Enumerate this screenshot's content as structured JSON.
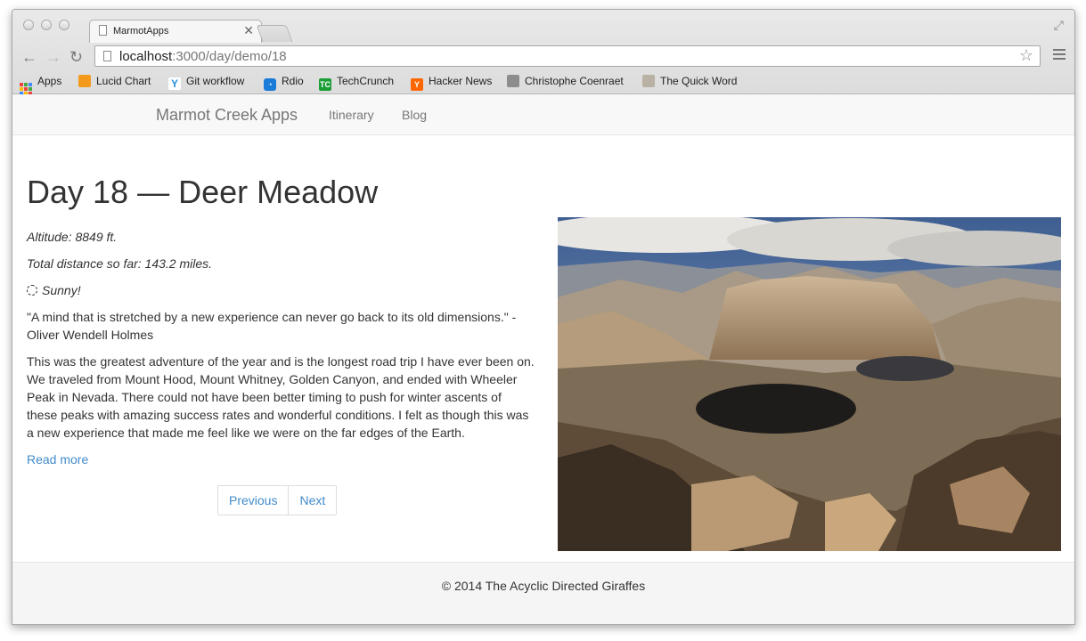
{
  "browser": {
    "tab_title": "MarmotApps",
    "url_host": "localhost",
    "url_rest": ":3000/day/demo/18",
    "bookmarks": [
      {
        "label": "Apps",
        "icon": "apps-grid-icon"
      },
      {
        "label": "Lucid Chart",
        "icon": "lucidchart-icon"
      },
      {
        "label": "Git workflow",
        "icon": "git-workflow-icon"
      },
      {
        "label": "Rdio",
        "icon": "rdio-icon"
      },
      {
        "label": "TechCrunch",
        "icon": "techcrunch-icon"
      },
      {
        "label": "Hacker News",
        "icon": "hacker-news-icon"
      },
      {
        "label": "Christophe Coenraet",
        "icon": "avatar-icon"
      },
      {
        "label": "The Quick Word",
        "icon": "quick-word-icon"
      }
    ]
  },
  "nav": {
    "brand": "Marmot Creek Apps",
    "links": [
      "Itinerary",
      "Blog"
    ]
  },
  "page": {
    "title": "Day 18 — Deer Meadow",
    "altitude": "Altitude: 8849 ft.",
    "distance": "Total distance so far: 143.2 miles.",
    "weather": "Sunny!",
    "quote": "\"A mind that is stretched by a new experience can never go back to its old dimensions.\" -Oliver Wendell Holmes",
    "body": "This was the greatest adventure of the year and is the longest road trip I have ever been on. We traveled from Mount Hood, Mount Whitney, Golden Canyon, and ended with Wheeler Peak in Nevada. There could not have been better timing to push for winter ascents of these peaks with amazing success rates and wonderful conditions. I felt as though this was a new experience that made me feel like we were on the far edges of the Earth.",
    "read_more": "Read more",
    "pager": {
      "previous": "Previous",
      "next": "Next"
    }
  },
  "footer": {
    "text": "© 2014 The Acyclic Directed Giraffes"
  },
  "colors": {
    "link": "#428bca",
    "text": "#333333",
    "navbar_bg": "#f8f8f8"
  }
}
